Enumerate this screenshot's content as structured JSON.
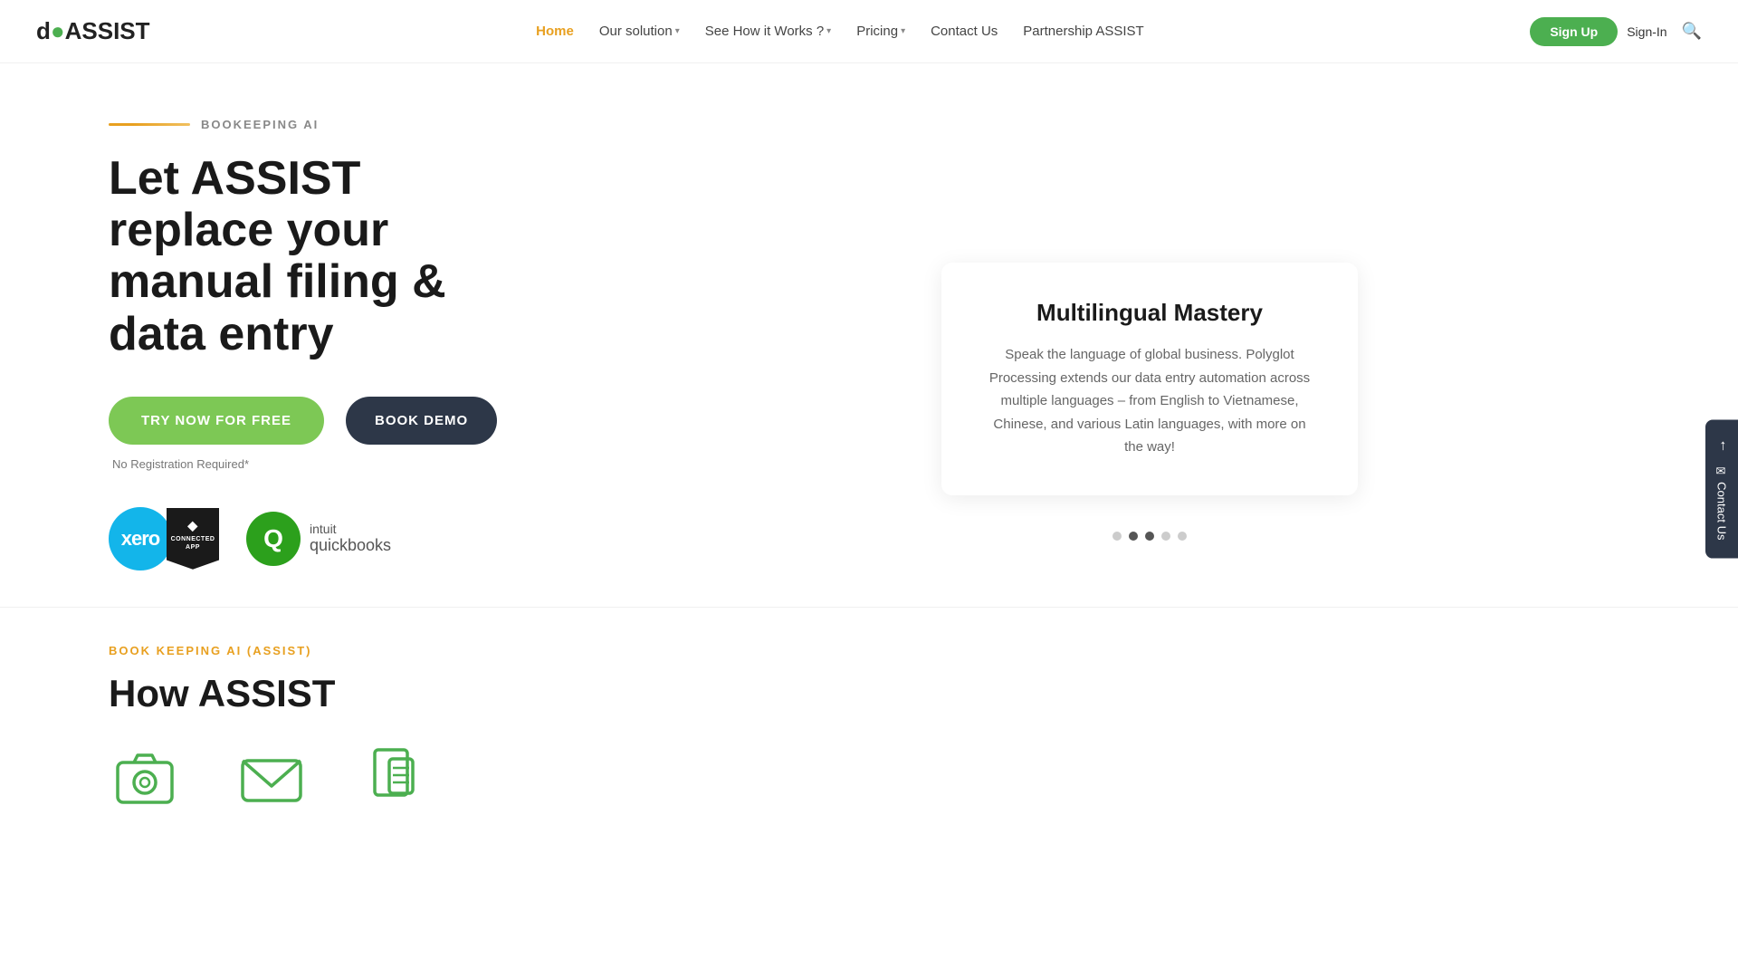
{
  "logo": {
    "text_prefix": "d",
    "text_suffix": "ASSIST",
    "dot": "●"
  },
  "nav": {
    "home_label": "Home",
    "solution_label": "Our solution",
    "how_works_label": "See How it Works ?",
    "pricing_label": "Pricing",
    "contact_label": "Contact Us",
    "partnership_label": "Partnership ASSIST",
    "signup_label": "Sign Up",
    "signin_label": "Sign-In"
  },
  "hero": {
    "eyebrow": "BOOKEEPING AI",
    "headline_line1": "Let ASSIST",
    "headline_line2": "replace your",
    "headline_line3": "manual filing &",
    "headline_line4": "data entry",
    "btn_try": "TRY NOW FOR FREE",
    "btn_demo": "BOOK DEMO",
    "note": "No Registration Required*",
    "xero_label": "xero",
    "connected_line1": "CONNECTED",
    "connected_line2": "APP",
    "qb_label_1": "intuit",
    "qb_label_2": "quickbooks"
  },
  "feature_card": {
    "title": "Multilingual Mastery",
    "body": "Speak the language of global business. Polyglot Processing extends our data entry automation across multiple languages – from English to Vietnamese, Chinese, and various Latin languages, with more on the way!"
  },
  "slider_dots": [
    {
      "active": false
    },
    {
      "active": true
    },
    {
      "active": true
    },
    {
      "active": false
    },
    {
      "active": false
    }
  ],
  "side_contact": {
    "arrow": "→",
    "label": "✉ Contact Us"
  },
  "bottom": {
    "eyebrow": "BOOK KEEPING AI (ASSIST)",
    "headline_line1": "How ASSIST"
  },
  "scroll_label": "How Assist"
}
